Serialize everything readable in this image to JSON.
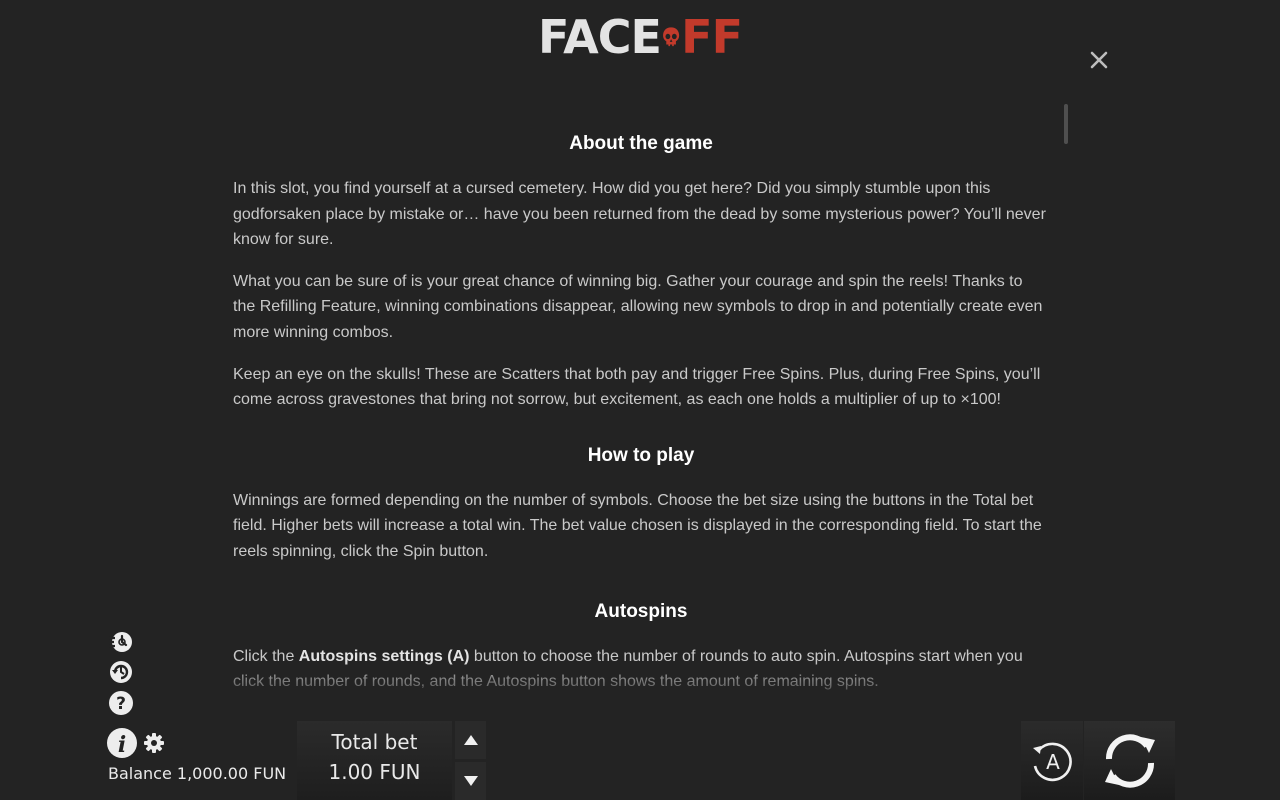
{
  "logo": {
    "part1": "FACE",
    "part2": "FF"
  },
  "sections": [
    {
      "title": "About the game",
      "paragraphs": [
        "In this slot, you find yourself at a cursed cemetery. How did you get here? Did you simply stumble upon this godforsaken place by mistake or… have you been returned from the dead by some mysterious power? You’ll never know for sure.",
        "What you can be sure of is your great chance of winning big. Gather your courage and spin the reels! Thanks to the Refilling Feature, winning combinations disappear, allowing new symbols to drop in and potentially create even more winning combos.",
        "Keep an eye on the skulls! These are Scatters that both pay and trigger Free Spins. Plus, during Free Spins, you’ll come across gravestones that bring not sorrow, but excitement, as each one holds a multiplier of up to ×100!"
      ]
    },
    {
      "title": "How to play",
      "paragraphs": [
        "Winnings are formed depending on the number of symbols. Choose the bet size using the buttons in the Total bet field. Higher bets will increase a total win. The bet value chosen is displayed in the corresponding field. To start the reels spinning, click the Spin button."
      ]
    },
    {
      "title": "Autospins",
      "paragraph_pre": "Click the ",
      "paragraph_bold": "Autospins settings (A)",
      "paragraph_post": " button to choose the number of rounds to auto spin. Autospins start when you click the number of rounds, and the Autospins button shows the amount of remaining spins."
    }
  ],
  "balance": {
    "label": "Balance",
    "value": "1,000.00 FUN"
  },
  "total_bet": {
    "label": "Total bet",
    "value": "1.00 FUN"
  },
  "auto_button": {
    "label": "A"
  },
  "icons": {
    "close": "close-icon",
    "turbo": "turbo-icon",
    "quick_spin": "quick-spin-icon",
    "help": "help-icon",
    "info": "info-icon",
    "settings": "gear-icon",
    "bet_up": "arrow-up-icon",
    "bet_down": "arrow-down-icon",
    "autospin": "autospin-icon",
    "spin": "spin-icon"
  },
  "colors": {
    "background": "#232323",
    "logo_red": "#c23a2b",
    "text": "#c9c9c9",
    "heading": "#ffffff"
  }
}
